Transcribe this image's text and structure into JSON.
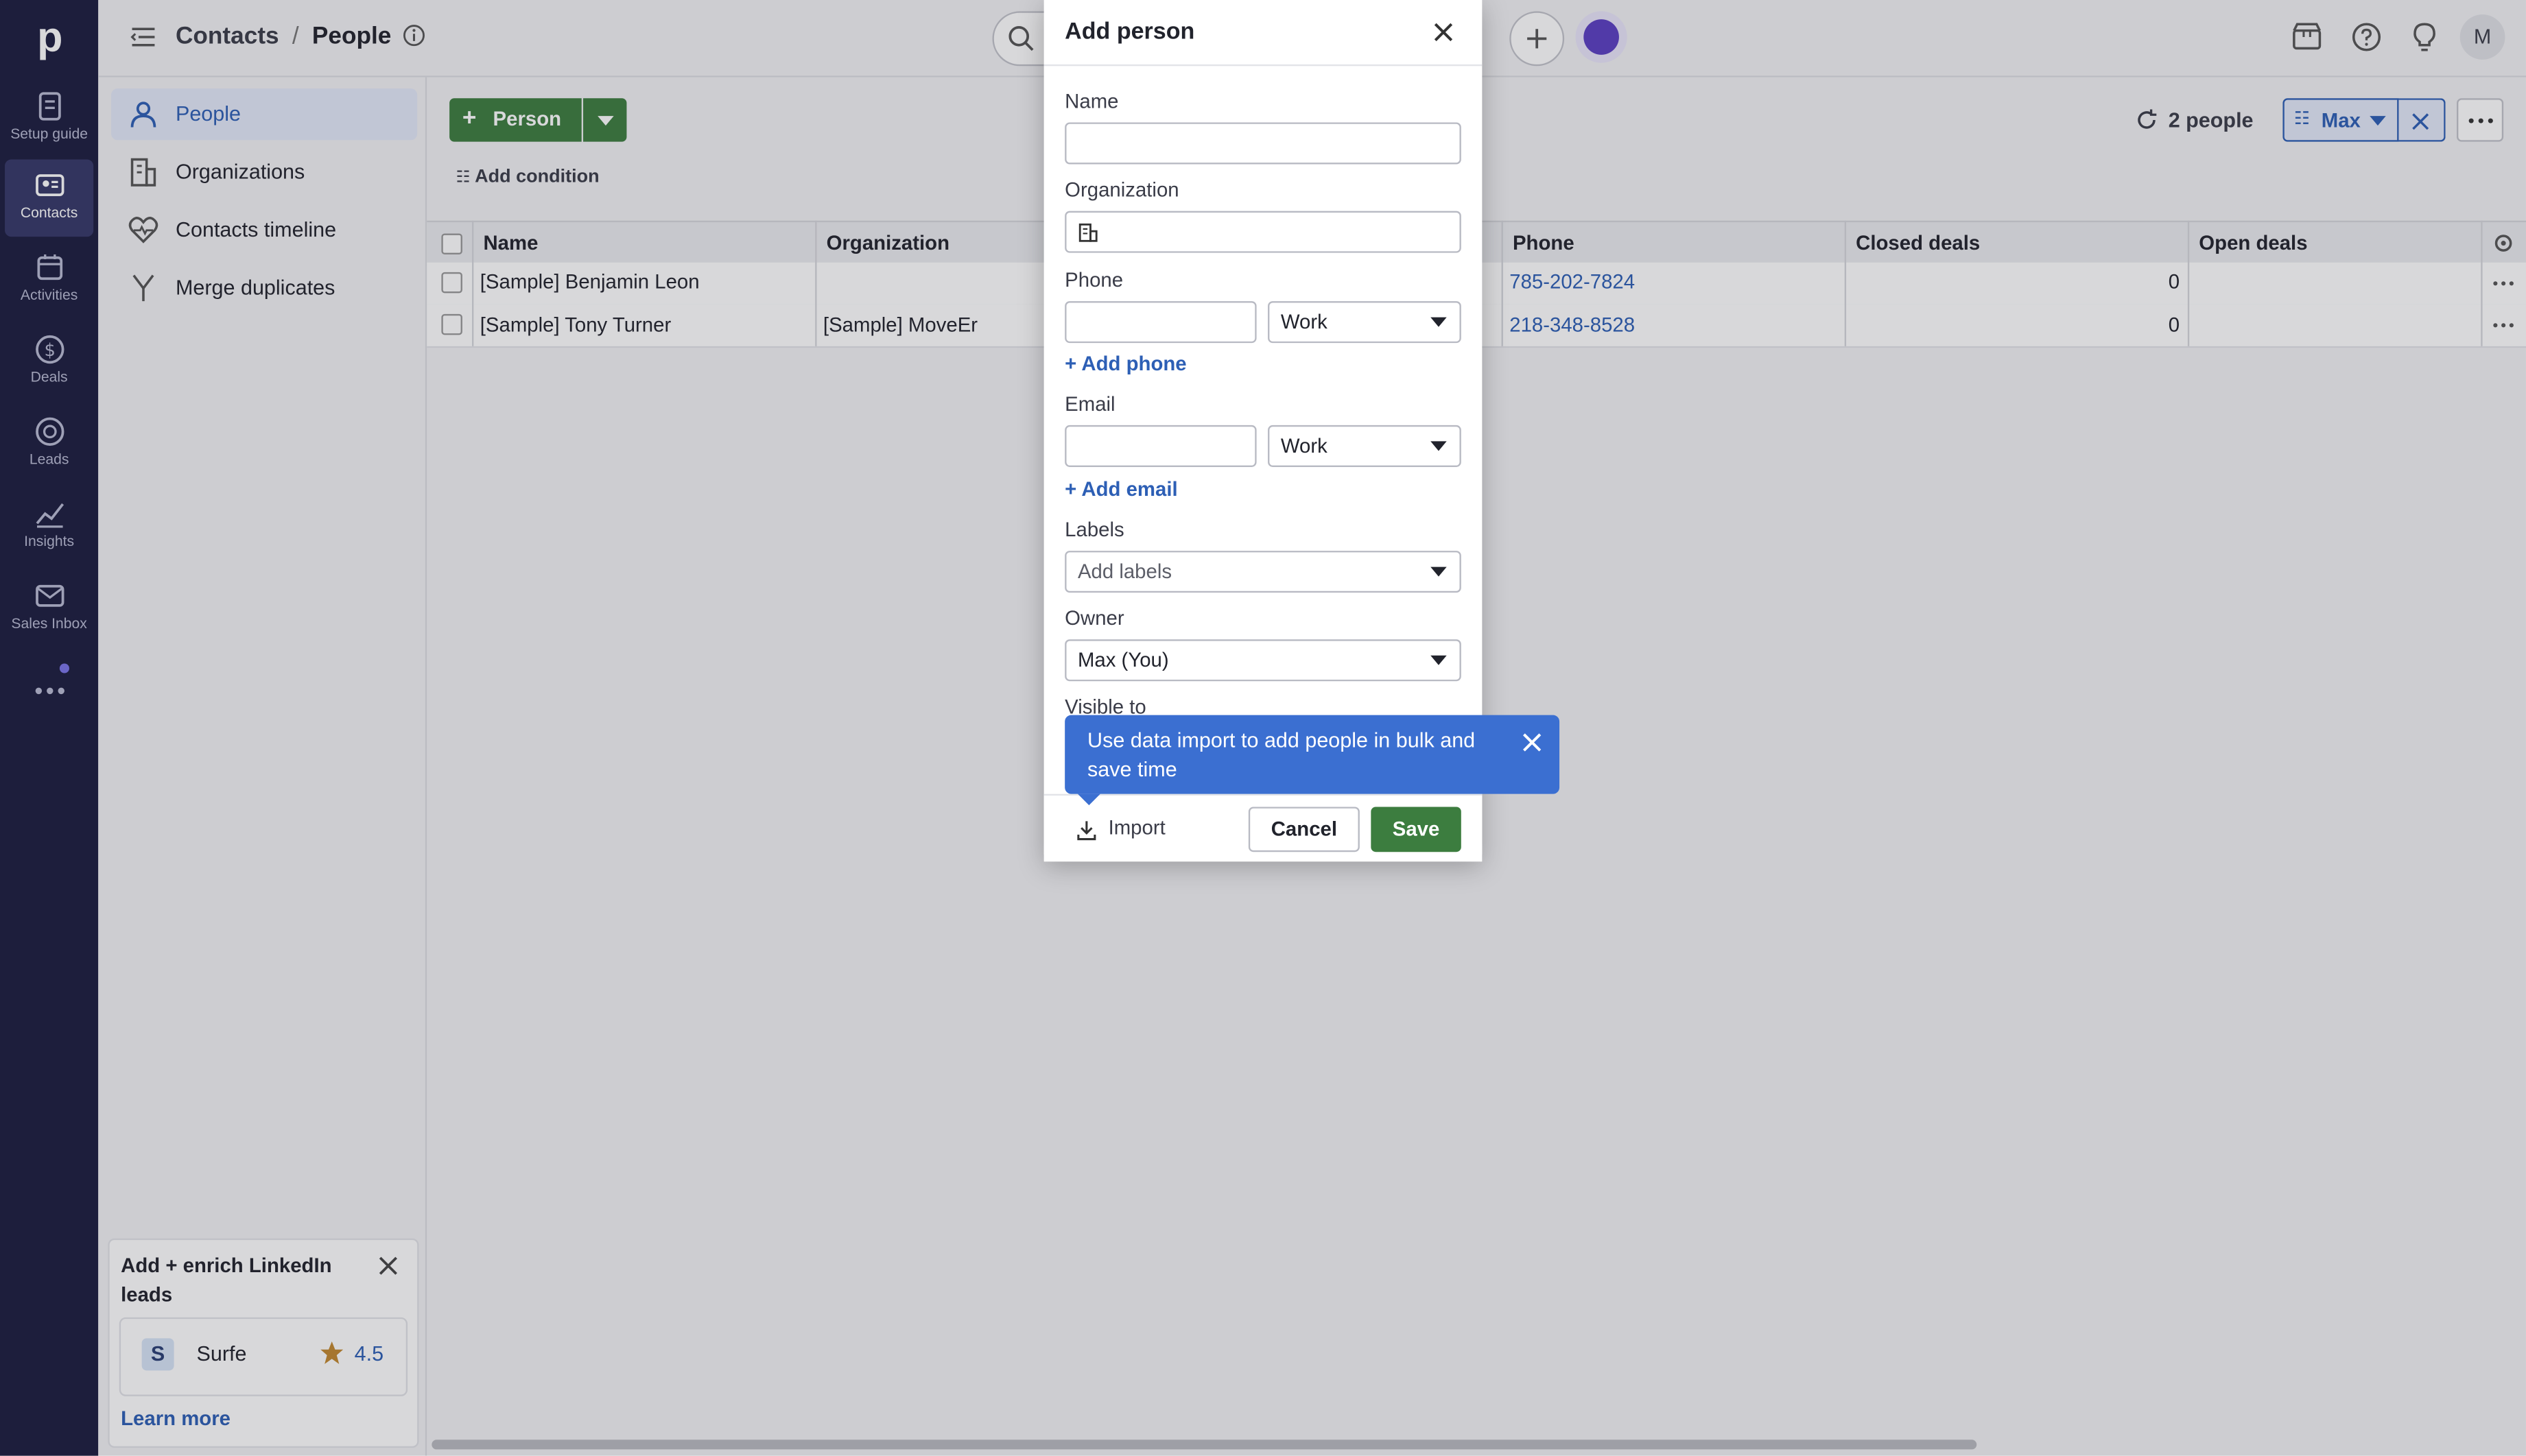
{
  "nav": {
    "items": [
      {
        "label": "Setup guide",
        "icon": "setup-guide-icon"
      },
      {
        "label": "Contacts",
        "icon": "contacts-icon"
      },
      {
        "label": "Activities",
        "icon": "calendar-icon"
      },
      {
        "label": "Deals",
        "icon": "dollar-icon"
      },
      {
        "label": "Leads",
        "icon": "target-icon"
      },
      {
        "label": "Insights",
        "icon": "chart-icon"
      },
      {
        "label": "Sales Inbox",
        "icon": "mail-icon"
      }
    ],
    "logo": "p"
  },
  "header": {
    "breadcrumb_section": "Contacts",
    "breadcrumb_sep": "/",
    "breadcrumb_page": "People",
    "avatar_initial": "M"
  },
  "subnav": {
    "items": [
      {
        "label": "People"
      },
      {
        "label": "Organizations"
      },
      {
        "label": "Contacts timeline"
      },
      {
        "label": "Merge duplicates"
      }
    ]
  },
  "promo": {
    "title": "Add + enrich LinkedIn leads",
    "app_name": "Surfe",
    "app_letter": "S",
    "rating": "4.5",
    "learn_more": "Learn more"
  },
  "toolbar": {
    "add_person_label": "Person",
    "add_condition": "Add condition",
    "people_count": "2 people",
    "filter_owner": "Max"
  },
  "table": {
    "columns": [
      "Name",
      "Organization",
      "Phone",
      "Closed deals",
      "Open deals"
    ],
    "rows": [
      {
        "name": "[Sample] Benjamin Leon",
        "organization": "",
        "phone": "785-202-7824",
        "closed_deals": "0"
      },
      {
        "name": "[Sample] Tony Turner",
        "organization": "[Sample] MoveEr",
        "phone": "218-348-8528",
        "closed_deals": "0"
      }
    ]
  },
  "modal": {
    "title": "Add person",
    "name_label": "Name",
    "name_value": "",
    "org_label": "Organization",
    "org_value": "",
    "phone_label": "Phone",
    "phone_value": "",
    "phone_type": "Work",
    "add_phone": "+ Add phone",
    "email_label": "Email",
    "email_value": "",
    "email_type": "Work",
    "add_email": "+ Add email",
    "labels_label": "Labels",
    "labels_placeholder": "Add labels",
    "owner_label": "Owner",
    "owner_value": "Max (You)",
    "visible_label": "Visible to",
    "import_label": "Import",
    "cancel_label": "Cancel",
    "save_label": "Save"
  },
  "tooltip": {
    "text": "Use data import to add people in bulk and save time"
  },
  "colors": {
    "nav_bg": "#1c1d3f",
    "primary_green": "#3c7d3f",
    "link_blue": "#2d5fb5",
    "tooltip_blue": "#3b6fd1"
  }
}
